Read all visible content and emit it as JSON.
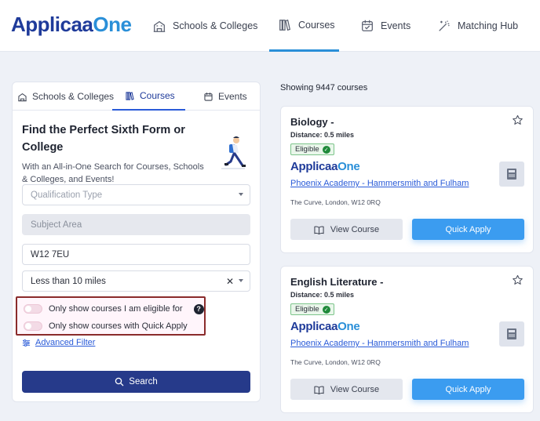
{
  "brand": {
    "name_part1": "Applicaa",
    "name_part2": "One"
  },
  "nav": {
    "items": [
      {
        "label": "Schools & Colleges",
        "icon": "school-icon"
      },
      {
        "label": "Courses",
        "icon": "books-icon",
        "active": true
      },
      {
        "label": "Events",
        "icon": "calendar-icon"
      },
      {
        "label": "Matching Hub",
        "icon": "magic-wand-icon"
      }
    ]
  },
  "search_panel": {
    "tabs": [
      {
        "label": "Schools & Colleges",
        "icon": "school-icon"
      },
      {
        "label": "Courses",
        "icon": "books-icon",
        "active": true
      },
      {
        "label": "Events",
        "icon": "calendar-icon"
      }
    ],
    "title": "Find the Perfect Sixth Form or College",
    "subtitle": "With an All-in-One Search for Courses, Schools & Colleges, and Events!",
    "qualification_placeholder": "Qualification Type",
    "subject_placeholder": "Subject Area",
    "postcode_value": "W12 7EU",
    "distance_value": "Less than 10 miles",
    "toggle_eligible": "Only show courses I am eligible for",
    "toggle_quick_apply": "Only show courses with Quick Apply",
    "help_symbol": "?",
    "advanced_filter": "Advanced Filter",
    "search_button": "Search"
  },
  "results": {
    "showing_text": "Showing 9447 courses",
    "courses": [
      {
        "title": "Biology -",
        "distance": "Distance: 0.5 miles",
        "badge": "Eligible",
        "logo_part1": "Applicaa",
        "logo_part2": "One",
        "school": "Phoenix Academy - Hammersmith and Fulham",
        "address": "The Curve, London, W12 0RQ",
        "view_label": "View Course",
        "apply_label": "Quick Apply"
      },
      {
        "title": "English Literature -",
        "distance": "Distance: 0.5 miles",
        "badge": "Eligible",
        "logo_part1": "Applicaa",
        "logo_part2": "One",
        "school": "Phoenix Academy - Hammersmith and Fulham",
        "address": "The Curve, London, W12 0RQ",
        "view_label": "View Course",
        "apply_label": "Quick Apply"
      }
    ]
  },
  "colors": {
    "brand_dark": "#1f3b9a",
    "brand_light": "#2a8fd8",
    "search_button": "#263a8a",
    "quick_apply": "#3b9cf0",
    "eligible_green": "#1f8a3a",
    "highlight_border": "#8a2b2b"
  }
}
